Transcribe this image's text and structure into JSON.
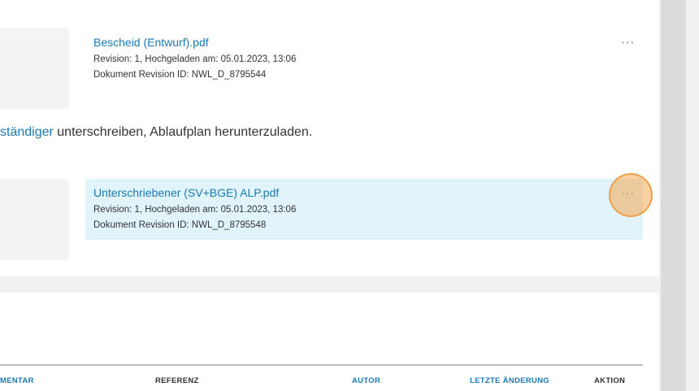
{
  "documents": [
    {
      "name": "Bescheid (Entwurf).pdf",
      "revision_line": "Revision: 1, Hochgeladen am: 05.01.2023, 13:06",
      "id_line": "Dokument Revision ID: NWL_D_8795544",
      "more_label": "···"
    },
    {
      "name": "Unterschriebener (SV+BGE) ALP.pdf",
      "revision_line": "Revision: 1, Hochgeladen am: 05.01.2023, 13:06",
      "id_line": "Dokument Revision ID: NWL_D_8795548",
      "more_label": "···"
    }
  ],
  "instruction": {
    "link_text": "ständiger",
    "rest_text": " unterschreiben, Ablaufplan herunterzuladen."
  },
  "table": {
    "headers": [
      "MENTAR",
      "REFERENZ",
      "AUTOR",
      "LETZTE ÄNDERUNG",
      "AKTION"
    ]
  },
  "colors": {
    "link": "#1a7ab3",
    "highlight_row": "#e1f3fb",
    "click_indicator": "#f0a04b"
  }
}
